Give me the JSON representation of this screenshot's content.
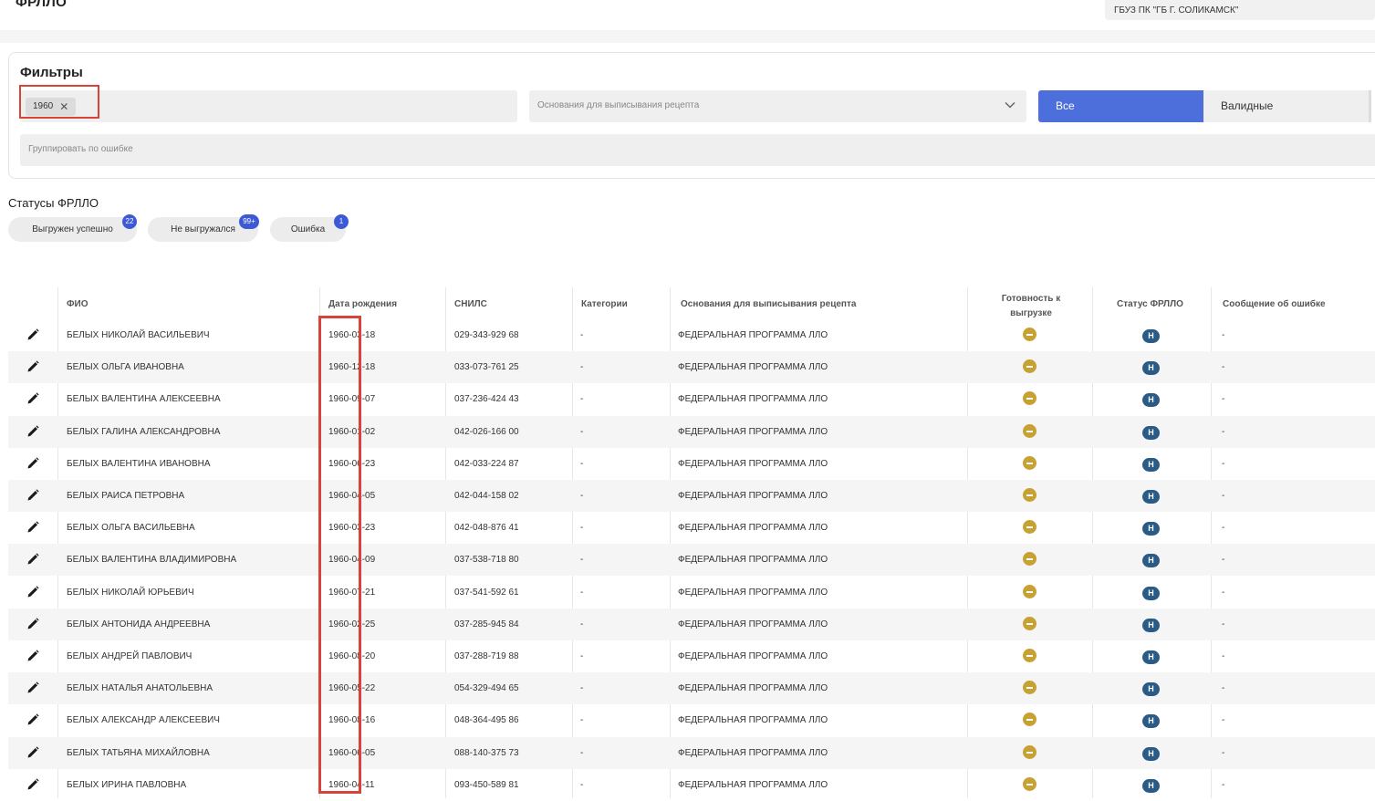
{
  "header": {
    "title": "ФРЛЛО",
    "org_value": "ГБУЗ ПК \"ГБ Г. СОЛИКАМСК\""
  },
  "filters": {
    "title": "Фильтры",
    "tag_chip": "1960",
    "basis_placeholder": "Основания для выписывания рецепта",
    "seg_all": "Все",
    "seg_valid": "Валидные",
    "group_placeholder": "Группировать по ошибке"
  },
  "statuses": {
    "title": "Статусы ФРЛЛО",
    "items": [
      {
        "label": "Выгружен успешно",
        "count": "22"
      },
      {
        "label": "Не выгружался",
        "count": "99+"
      },
      {
        "label": "Ошибка",
        "count": "1"
      }
    ]
  },
  "table": {
    "headers": {
      "fio": "ФИО",
      "dob": "Дата рождения",
      "snils": "СНИЛС",
      "category": "Категории",
      "basis": "Основания для выписывания рецепта",
      "ready_line1": "Готовность к",
      "ready_line2": "выгрузке",
      "frllo_status": "Статус ФРЛЛО",
      "error_msg": "Сообщение об ошибке"
    },
    "status_letter": "Н",
    "rows": [
      {
        "fio": "БЕЛЫХ НИКОЛАЙ ВАСИЛЬЕВИЧ",
        "dob": "1960-03-18",
        "snils": "029-343-929 68",
        "category": "-",
        "basis": "ФЕДЕРАЛЬНАЯ ПРОГРАММА ЛЛО",
        "error": "-"
      },
      {
        "fio": "БЕЛЫХ ОЛЬГА ИВАНОВНА",
        "dob": "1960-12-18",
        "snils": "033-073-761 25",
        "category": "-",
        "basis": "ФЕДЕРАЛЬНАЯ ПРОГРАММА ЛЛО",
        "error": "-"
      },
      {
        "fio": "БЕЛЫХ ВАЛЕНТИНА АЛЕКСЕЕВНА",
        "dob": "1960-09-07",
        "snils": "037-236-424 43",
        "category": "-",
        "basis": "ФЕДЕРАЛЬНАЯ ПРОГРАММА ЛЛО",
        "error": "-"
      },
      {
        "fio": "БЕЛЫХ ГАЛИНА АЛЕКСАНДРОВНА",
        "dob": "1960-01-02",
        "snils": "042-026-166 00",
        "category": "-",
        "basis": "ФЕДЕРАЛЬНАЯ ПРОГРАММА ЛЛО",
        "error": "-"
      },
      {
        "fio": "БЕЛЫХ ВАЛЕНТИНА ИВАНОВНА",
        "dob": "1960-06-23",
        "snils": "042-033-224 87",
        "category": "-",
        "basis": "ФЕДЕРАЛЬНАЯ ПРОГРАММА ЛЛО",
        "error": "-"
      },
      {
        "fio": "БЕЛЫХ РАИСА ПЕТРОВНА",
        "dob": "1960-04-05",
        "snils": "042-044-158 02",
        "category": "-",
        "basis": "ФЕДЕРАЛЬНАЯ ПРОГРАММА ЛЛО",
        "error": "-"
      },
      {
        "fio": "БЕЛЫХ ОЛЬГА ВАСИЛЬЕВНА",
        "dob": "1960-03-23",
        "snils": "042-048-876 41",
        "category": "-",
        "basis": "ФЕДЕРАЛЬНАЯ ПРОГРАММА ЛЛО",
        "error": "-"
      },
      {
        "fio": "БЕЛЫХ ВАЛЕНТИНА ВЛАДИМИРОВНА",
        "dob": "1960-04-09",
        "snils": "037-538-718 80",
        "category": "-",
        "basis": "ФЕДЕРАЛЬНАЯ ПРОГРАММА ЛЛО",
        "error": "-"
      },
      {
        "fio": "БЕЛЫХ НИКОЛАЙ ЮРЬЕВИЧ",
        "dob": "1960-07-21",
        "snils": "037-541-592 61",
        "category": "-",
        "basis": "ФЕДЕРАЛЬНАЯ ПРОГРАММА ЛЛО",
        "error": "-"
      },
      {
        "fio": "БЕЛЫХ АНТОНИДА АНДРЕЕВНА",
        "dob": "1960-02-25",
        "snils": "037-285-945 84",
        "category": "-",
        "basis": "ФЕДЕРАЛЬНАЯ ПРОГРАММА ЛЛО",
        "error": "-"
      },
      {
        "fio": "БЕЛЫХ АНДРЕЙ ПАВЛОВИЧ",
        "dob": "1960-08-20",
        "snils": "037-288-719 88",
        "category": "-",
        "basis": "ФЕДЕРАЛЬНАЯ ПРОГРАММА ЛЛО",
        "error": "-"
      },
      {
        "fio": "БЕЛЫХ НАТАЛЬЯ АНАТОЛЬЕВНА",
        "dob": "1960-05-22",
        "snils": "054-329-494 65",
        "category": "-",
        "basis": "ФЕДЕРАЛЬНАЯ ПРОГРАММА ЛЛО",
        "error": "-"
      },
      {
        "fio": "БЕЛЫХ АЛЕКСАНДР АЛЕКСЕЕВИЧ",
        "dob": "1960-08-16",
        "snils": "048-364-495 86",
        "category": "-",
        "basis": "ФЕДЕРАЛЬНАЯ ПРОГРАММА ЛЛО",
        "error": "-"
      },
      {
        "fio": "БЕЛЫХ ТАТЬЯНА МИХАЙЛОВНА",
        "dob": "1960-06-05",
        "snils": "088-140-375 73",
        "category": "-",
        "basis": "ФЕДЕРАЛЬНАЯ ПРОГРАММА ЛЛО",
        "error": "-"
      },
      {
        "fio": "БЕЛЫХ ИРИНА ПАВЛОВНА",
        "dob": "1960-04-11",
        "snils": "093-450-589 81",
        "category": "-",
        "basis": "ФЕДЕРАЛЬНАЯ ПРОГРАММА ЛЛО",
        "error": "-"
      }
    ]
  },
  "colors": {
    "accent": "#4c6fdb",
    "badge": "#3d5ad6",
    "highlight": "#d9443a",
    "ready": "#c7a233",
    "status_badge": "#2a5a86"
  }
}
